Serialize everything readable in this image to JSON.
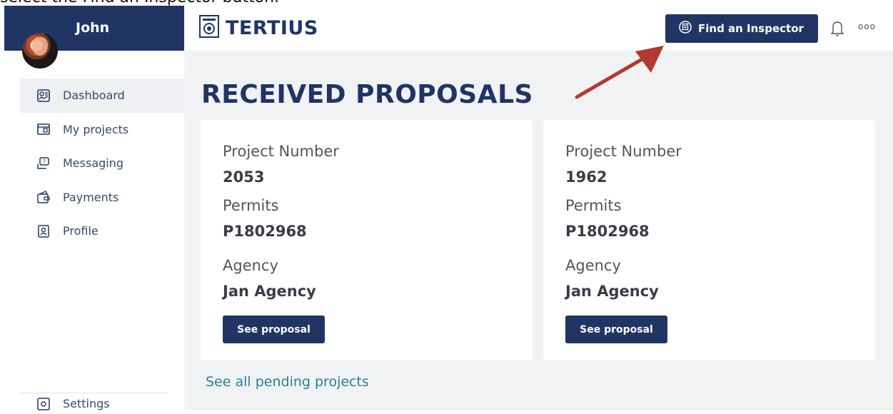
{
  "instruction": {
    "text": "select the Find an Inspector button."
  },
  "sidebar": {
    "user_name": "John",
    "items": [
      {
        "label": "Dashboard",
        "icon": "dashboard-icon",
        "active": true
      },
      {
        "label": "My projects",
        "icon": "projects-icon",
        "active": false
      },
      {
        "label": "Messaging",
        "icon": "messaging-icon",
        "active": false
      },
      {
        "label": "Payments",
        "icon": "payments-icon",
        "active": false
      },
      {
        "label": "Profile",
        "icon": "profile-icon",
        "active": false
      }
    ],
    "settings_label": "Settings"
  },
  "header": {
    "brand": "TERTIUS",
    "find_inspector_label": "Find an Inspector",
    "notification_icon": "bell-icon",
    "more_label": "ooo"
  },
  "main": {
    "title": "RECEIVED PROPOSALS",
    "cards": [
      {
        "project_number_label": "Project Number",
        "project_number": "2053",
        "permits_label": "Permits",
        "permits": "P1802968",
        "agency_label": "Agency",
        "agency": "Jan Agency",
        "button_label": "See proposal"
      },
      {
        "project_number_label": "Project Number",
        "project_number": "1962",
        "permits_label": "Permits",
        "permits": "P1802968",
        "agency_label": "Agency",
        "agency": "Jan Agency",
        "button_label": "See proposal"
      }
    ],
    "pending_link": "See all pending projects"
  },
  "colors": {
    "brand_navy": "#203564",
    "page_bg": "#f1f2f4",
    "link": "#2a7f99",
    "annotation_arrow": "#b23a2e"
  }
}
